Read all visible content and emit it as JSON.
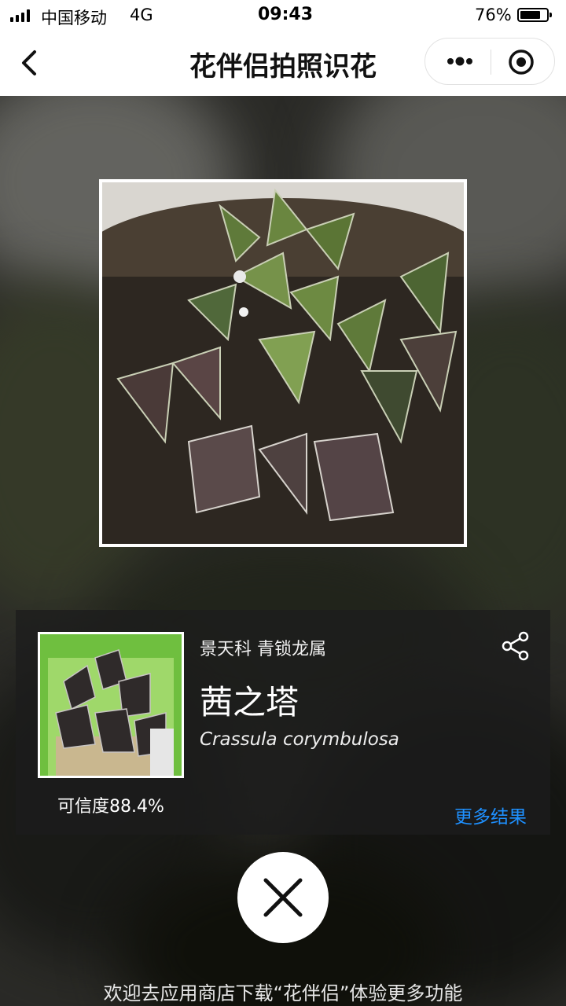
{
  "status_bar": {
    "carrier": "中国移动",
    "network": "4G",
    "time": "09:43",
    "battery": "76%",
    "battery_level": 0.76
  },
  "nav": {
    "title": "花伴侣拍照识花",
    "back_icon": "chevron-left-icon",
    "more_icon": "more-dots-icon",
    "close_icon": "target-circle-icon"
  },
  "result": {
    "family": "景天科 青锁龙属",
    "name": "茜之塔",
    "latin": "Crassula corymbulosa",
    "confidence": "可信度88.4%",
    "more_results": "更多结果",
    "share_icon": "share-icon"
  },
  "footer": {
    "text": "欢迎去应用商店下载“花伴侣”体验更多功能"
  },
  "colors": {
    "accent": "#1e90ff",
    "panel": "#1c1c1c"
  }
}
